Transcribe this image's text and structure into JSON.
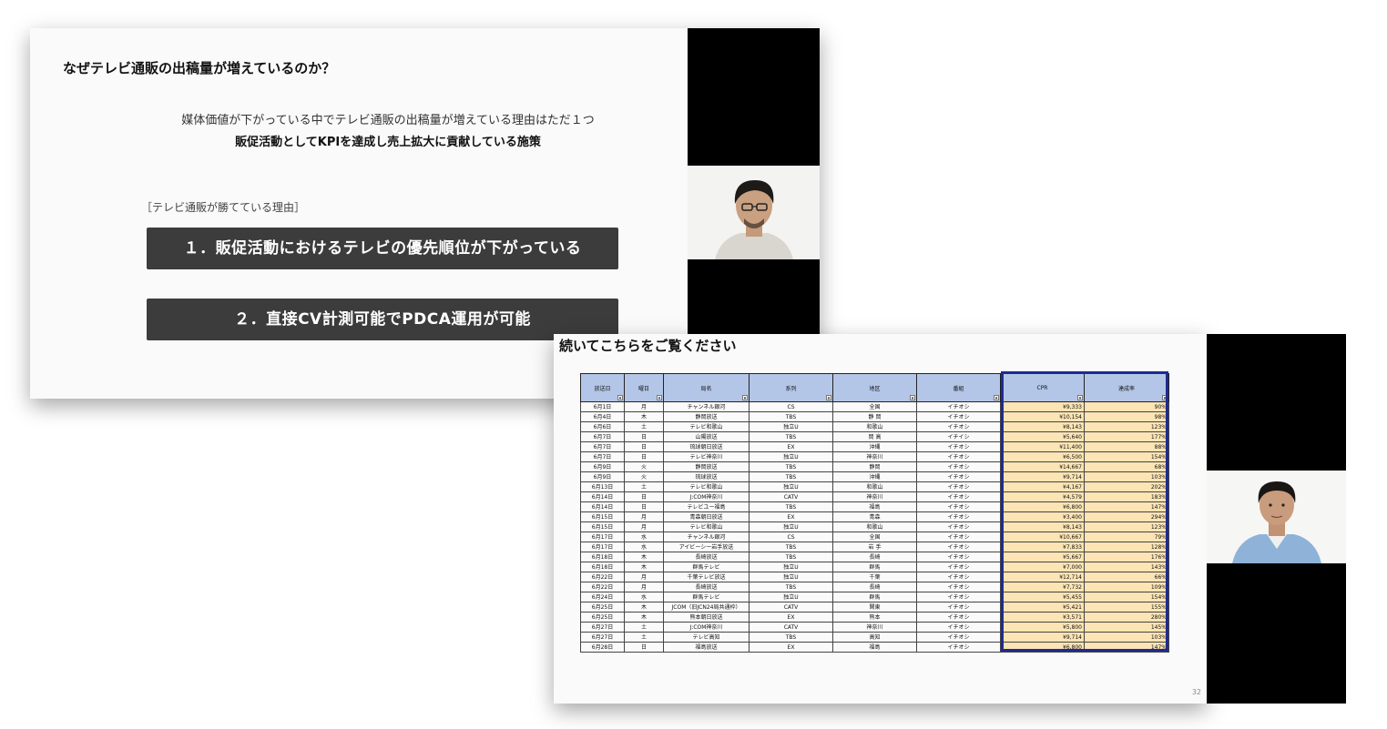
{
  "slide1": {
    "title": "なぜテレビ通販の出稿量が増えているのか？",
    "subtitle_line1": "媒体価値が下がっている中でテレビ通販の出稿量が増えている理由はただ１つ",
    "subtitle_line2": "販促活動としてKPIを達成し売上拡大に貢献している施策",
    "reasons_heading": "［テレビ通販が勝てている理由］",
    "reason1": "１．販促活動におけるテレビの優先順位が下がっている",
    "reason2": "２．直接CV計測可能でPDCA運用が可能"
  },
  "slide2": {
    "title": "続いてこちらをご覧ください",
    "page_number": "32",
    "highlight_color": "#1f2a90",
    "table": {
      "headers": [
        "放送日",
        "曜日",
        "局名",
        "系列",
        "地区",
        "番組",
        "CPR",
        "達成率"
      ],
      "filter_icon": "▾",
      "rows": [
        [
          "6月1日",
          "月",
          "チャンネル銀河",
          "CS",
          "全国",
          "イチオシ",
          "¥9,333",
          "90%"
        ],
        [
          "6月4日",
          "木",
          "静岡放送",
          "TBS",
          "静 岡",
          "イチオシ",
          "¥10,154",
          "98%"
        ],
        [
          "6月6日",
          "土",
          "テレビ和歌山",
          "独立U",
          "和歌山",
          "イチオシ",
          "¥8,143",
          "123%"
        ],
        [
          "6月7日",
          "日",
          "山陽放送",
          "TBS",
          "岡 高",
          "イチイシ",
          "¥5,640",
          "177%"
        ],
        [
          "6月7日",
          "日",
          "琉球朝日放送",
          "EX",
          "沖縄",
          "イチオシ",
          "¥11,400",
          "88%"
        ],
        [
          "6月7日",
          "日",
          "テレビ神奈川",
          "独立U",
          "神奈川",
          "イチオシ",
          "¥6,500",
          "154%"
        ],
        [
          "6月9日",
          "火",
          "静岡放送",
          "TBS",
          "静岡",
          "イチオシ",
          "¥14,667",
          "68%"
        ],
        [
          "6月9日",
          "火",
          "琉球放送",
          "TBS",
          "沖縄",
          "イチオシ",
          "¥9,714",
          "103%"
        ],
        [
          "6月13日",
          "土",
          "テレビ和歌山",
          "独立U",
          "和歌山",
          "イチオシ",
          "¥4,167",
          "202%"
        ],
        [
          "6月14日",
          "日",
          "J:COM神奈川",
          "CATV",
          "神奈川",
          "イチオシ",
          "¥4,579",
          "183%"
        ],
        [
          "6月14日",
          "日",
          "テレビユー福島",
          "TBS",
          "福島",
          "イチオシ",
          "¥6,800",
          "147%"
        ],
        [
          "6月15日",
          "月",
          "青森朝日放送",
          "EX",
          "青森",
          "イチオシ",
          "¥3,400",
          "294%"
        ],
        [
          "6月15日",
          "月",
          "テレビ和歌山",
          "独立U",
          "和歌山",
          "イチオシ",
          "¥8,143",
          "123%"
        ],
        [
          "6月17日",
          "水",
          "チャンネル銀河",
          "CS",
          "全国",
          "イチオシ",
          "¥10,667",
          "79%"
        ],
        [
          "6月17日",
          "水",
          "アイビーシー岩手放送",
          "TBS",
          "岩 手",
          "イチオシ",
          "¥7,833",
          "128%"
        ],
        [
          "6月18日",
          "木",
          "長崎放送",
          "TBS",
          "長崎",
          "イチオシ",
          "¥5,667",
          "176%"
        ],
        [
          "6月18日",
          "木",
          "群馬テレビ",
          "独立U",
          "群馬",
          "イチオシ",
          "¥7,000",
          "143%"
        ],
        [
          "6月22日",
          "月",
          "千葉テレビ放送",
          "独立U",
          "千葉",
          "イチオシ",
          "¥12,714",
          "66%"
        ],
        [
          "6月22日",
          "月",
          "長崎放送",
          "TBS",
          "長崎",
          "イチオシ",
          "¥7,732",
          "109%"
        ],
        [
          "6月24日",
          "水",
          "群馬テレビ",
          "独立U",
          "群馬",
          "イチオシ",
          "¥5,455",
          "154%"
        ],
        [
          "6月25日",
          "木",
          "JCOM（旧JCN24局共通枠）",
          "CATV",
          "関東",
          "イチオシ",
          "¥5,421",
          "155%"
        ],
        [
          "6月25日",
          "木",
          "熊本朝日放送",
          "EX",
          "熊本",
          "イチオシ",
          "¥3,571",
          "280%"
        ],
        [
          "6月27日",
          "土",
          "J:COM神奈川",
          "CATV",
          "神奈川",
          "イチオシ",
          "¥5,800",
          "145%"
        ],
        [
          "6月27日",
          "土",
          "テレビ高知",
          "TBS",
          "高知",
          "イチオシ",
          "¥9,714",
          "103%"
        ],
        [
          "6月28日",
          "日",
          "福島放送",
          "EX",
          "福島",
          "イチオシ",
          "¥6,800",
          "147%"
        ]
      ]
    }
  }
}
